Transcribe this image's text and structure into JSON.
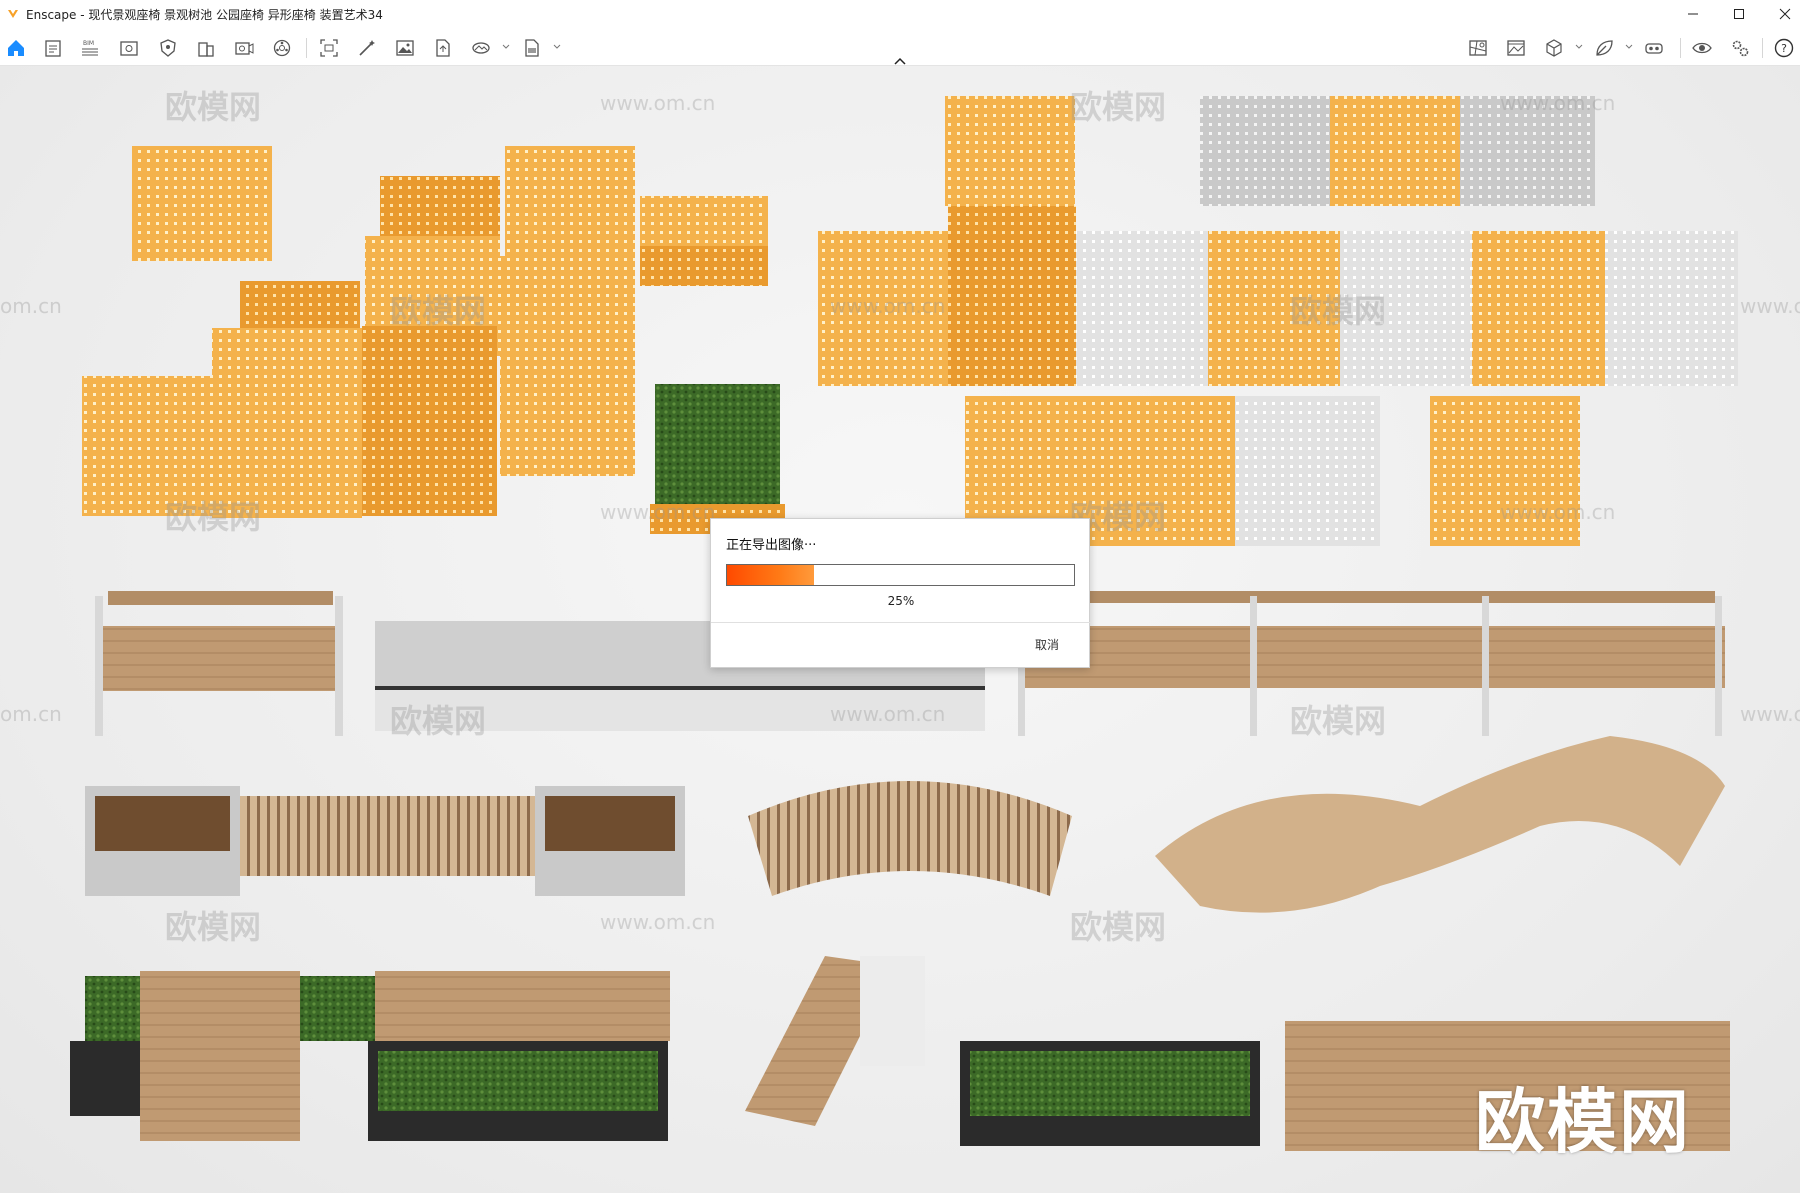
{
  "window": {
    "app_name": "Enscape",
    "title": "Enscape - 现代景观座椅 景观树池 公园座椅 异形座椅 装置艺术34"
  },
  "toolbar": {
    "left_icons": [
      "home-icon",
      "notes-icon",
      "bim-icon",
      "view-icon",
      "shield-icon",
      "building-icon",
      "video-camera-icon",
      "settings-wheel-icon",
      "screenshot-icon",
      "magic-wand-icon",
      "image-icon",
      "file-export-icon",
      "panorama-icon",
      "exe-export-icon"
    ],
    "bim_label": "BIM",
    "right_icons": [
      "map-icon",
      "gallery-icon",
      "cube-icon",
      "leaf-icon",
      "vr-headset-icon",
      "eye-icon",
      "settings-icon",
      "help-icon"
    ]
  },
  "dialog": {
    "title": "正在导出图像···",
    "progress_percent": 25,
    "progress_label": "25%",
    "cancel_label": "取消"
  },
  "watermarks": {
    "site_name": "欧模网",
    "url": "www.om.cn",
    "url_short": "om.cn",
    "url_right": "www.o"
  },
  "colors": {
    "accent_orange": "#ff7a16",
    "seat_orange": "#f5b24a",
    "wood": "#b9916a",
    "planter_dark": "#2b2b2b",
    "grass": "#3f6b2a"
  }
}
